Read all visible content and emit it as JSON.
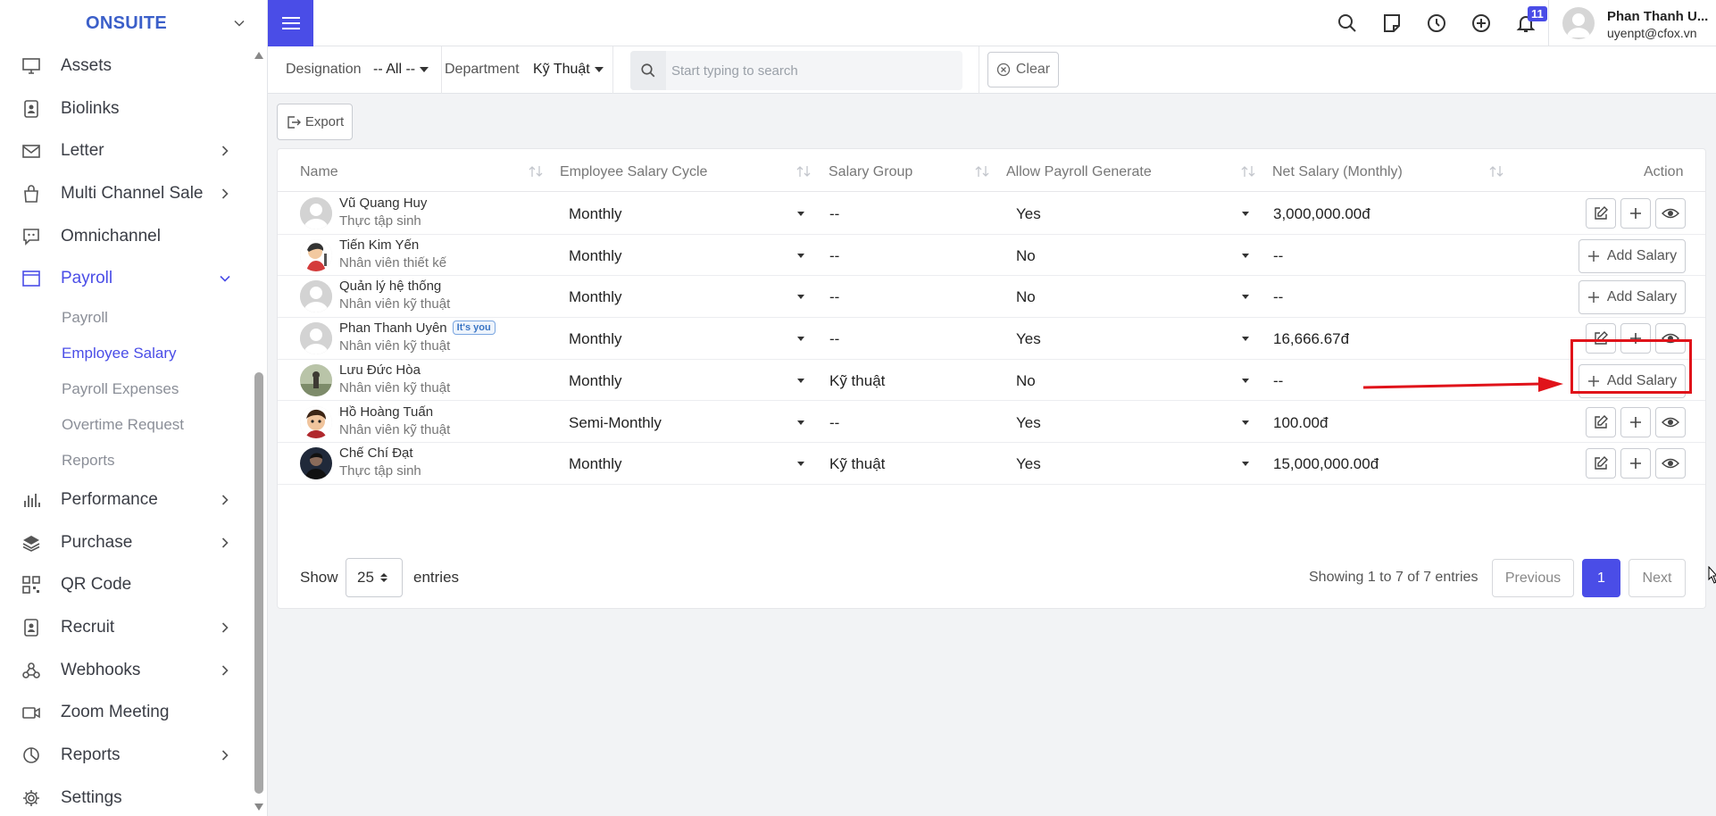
{
  "brand": {
    "name": "ONSUITE"
  },
  "sidebar": {
    "items": [
      {
        "label": "Assets",
        "icon": "monitor-icon",
        "arrow": false
      },
      {
        "label": "Biolinks",
        "icon": "id-badge-icon",
        "arrow": false
      },
      {
        "label": "Letter",
        "icon": "envelope-icon",
        "arrow": true
      },
      {
        "label": "Multi Channel Sale",
        "icon": "shopping-bag-icon",
        "arrow": true
      },
      {
        "label": "Omnichannel",
        "icon": "chat-icon",
        "arrow": false
      },
      {
        "label": "Payroll",
        "icon": "window-icon",
        "arrow": true,
        "active": true
      }
    ],
    "payroll_sub": [
      {
        "label": "Payroll"
      },
      {
        "label": "Employee Salary",
        "active": true
      },
      {
        "label": "Payroll Expenses"
      },
      {
        "label": "Overtime Request"
      },
      {
        "label": "Reports"
      }
    ],
    "items_after": [
      {
        "label": "Performance",
        "icon": "bar-chart-icon",
        "arrow": true
      },
      {
        "label": "Purchase",
        "icon": "layers-icon",
        "arrow": true
      },
      {
        "label": "QR Code",
        "icon": "qr-code-icon",
        "arrow": false
      },
      {
        "label": "Recruit",
        "icon": "id-badge-icon",
        "arrow": true
      },
      {
        "label": "Webhooks",
        "icon": "webhook-icon",
        "arrow": true
      },
      {
        "label": "Zoom Meeting",
        "icon": "video-icon",
        "arrow": false
      },
      {
        "label": "Reports",
        "icon": "pie-chart-icon",
        "arrow": true
      },
      {
        "label": "Settings",
        "icon": "gear-icon",
        "arrow": false
      }
    ]
  },
  "topbar": {
    "notification_count": "11",
    "user_name": "Phan Thanh U...",
    "user_email": "uyenpt@cfox.vn"
  },
  "filters": {
    "designation_label": "Designation",
    "designation_value": "-- All --",
    "department_label": "Department",
    "department_value": "Kỹ Thuật",
    "search_placeholder": "Start typing to search",
    "clear_label": "Clear"
  },
  "toolbar": {
    "export_label": "Export"
  },
  "table": {
    "headers": {
      "name": "Name",
      "cycle": "Employee Salary Cycle",
      "group": "Salary Group",
      "allow": "Allow Payroll Generate",
      "net": "Net Salary (Monthly)",
      "action": "Action"
    },
    "rows": [
      {
        "name": "Vũ Quang Huy",
        "title": "Thực tập sinh",
        "cycle": "Monthly",
        "group": "--",
        "allow": "Yes",
        "net": "3,000,000.00đ",
        "has_salary": true
      },
      {
        "name": "Tiến Kim Yến",
        "title": "Nhân viên thiết kế",
        "cycle": "Monthly",
        "group": "--",
        "allow": "No",
        "net": "--",
        "has_salary": false
      },
      {
        "name": "Quản lý hệ thống",
        "title": "Nhân viên kỹ thuật",
        "cycle": "Monthly",
        "group": "--",
        "allow": "No",
        "net": "--",
        "has_salary": false
      },
      {
        "name": "Phan Thanh Uyên",
        "title": "Nhân viên kỹ thuật",
        "cycle": "Monthly",
        "group": "--",
        "allow": "Yes",
        "net": "16,666.67đ",
        "has_salary": true,
        "badge": "It's you"
      },
      {
        "name": "Lưu Đức Hòa",
        "title": "Nhân viên kỹ thuật",
        "cycle": "Monthly",
        "group": "Kỹ thuật",
        "allow": "No",
        "net": "--",
        "has_salary": false
      },
      {
        "name": "Hồ Hoàng Tuấn",
        "title": "Nhân viên kỹ thuật",
        "cycle": "Semi-Monthly",
        "group": "--",
        "allow": "Yes",
        "net": "100.00đ",
        "has_salary": true
      },
      {
        "name": "Chế Chí Đạt",
        "title": "Thực tập sinh",
        "cycle": "Monthly",
        "group": "Kỹ thuật",
        "allow": "Yes",
        "net": "15,000,000.00đ",
        "has_salary": true
      }
    ],
    "add_salary_label": "Add Salary"
  },
  "footer": {
    "show_label": "Show",
    "page_size": "25",
    "entries_label": "entries",
    "showing_text": "Showing 1 to 7 of 7 entries",
    "prev_label": "Previous",
    "current_page": "1",
    "next_label": "Next"
  },
  "colors": {
    "accent": "#4a4de7",
    "annotation": "#e0131a"
  }
}
